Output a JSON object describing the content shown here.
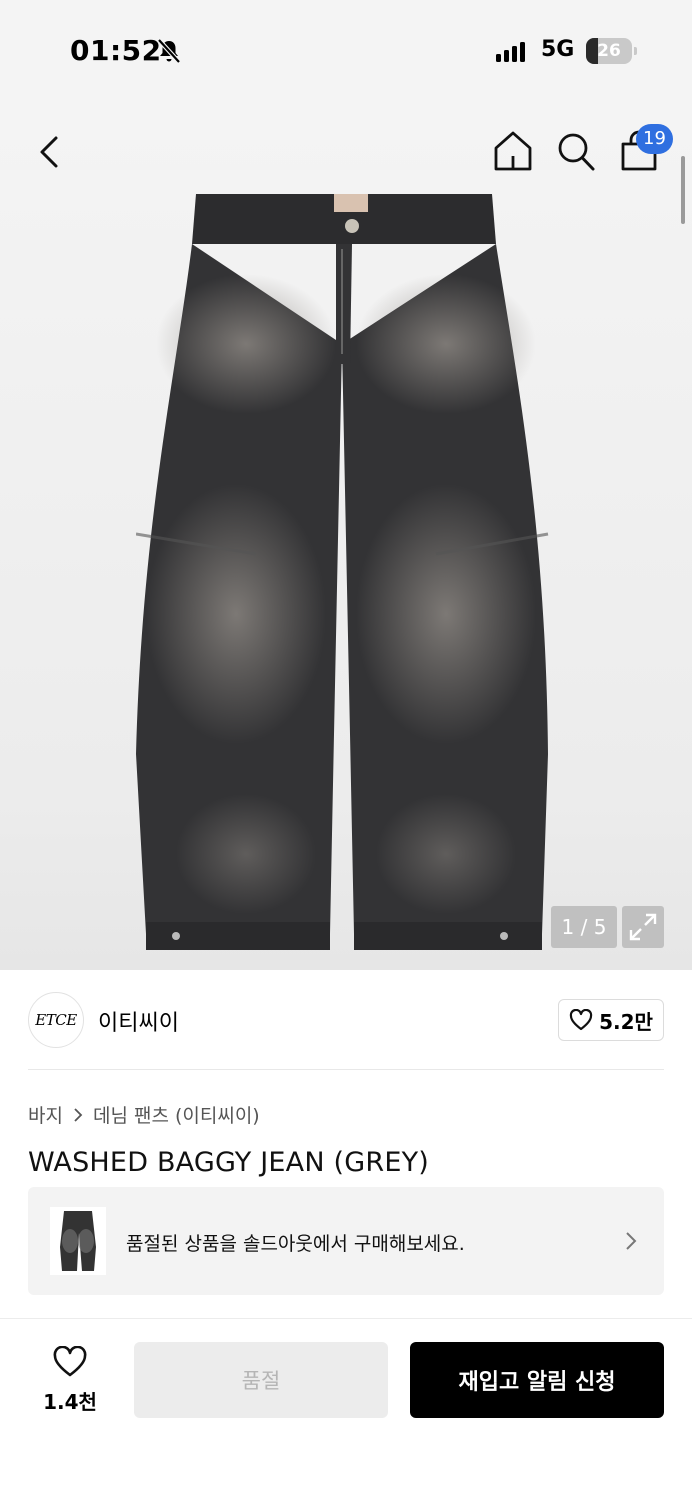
{
  "status_bar": {
    "time": "01:52",
    "network": "5G",
    "battery": "26",
    "battery_level": 0.26
  },
  "nav": {
    "cart_count": "19"
  },
  "gallery": {
    "pager": "1 / 5"
  },
  "brand": {
    "logo_text": "ETCE",
    "name": "이티씨이",
    "likes": "5.2만"
  },
  "breadcrumb": {
    "category": "바지",
    "subcategory": "데님 팬츠 (이티씨이)"
  },
  "product": {
    "title": "WASHED BAGGY JEAN (GREY)"
  },
  "soldout_card": {
    "text": "품절된 상품을 솔드아웃에서 구매해보세요."
  },
  "footer": {
    "like_count": "1.4천",
    "soldout_label": "품절",
    "restock_label": "재입고 알림 신청"
  },
  "colors": {
    "badge": "#2f6fe0",
    "primary_button": "#000000",
    "disabled_button": "#ececec"
  }
}
